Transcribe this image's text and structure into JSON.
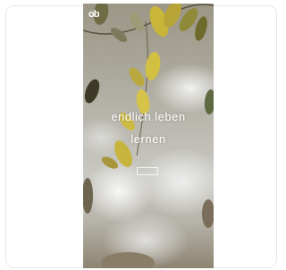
{
  "app": {
    "logo_text": "ob",
    "headline_line1": "endlich leben",
    "headline_line2": "lernen",
    "tagline": "",
    "cta_label": ""
  },
  "colors": {
    "leaf": "#c8b53a",
    "leaf_dark": "#6e6a2c",
    "text": "#ffffff"
  }
}
